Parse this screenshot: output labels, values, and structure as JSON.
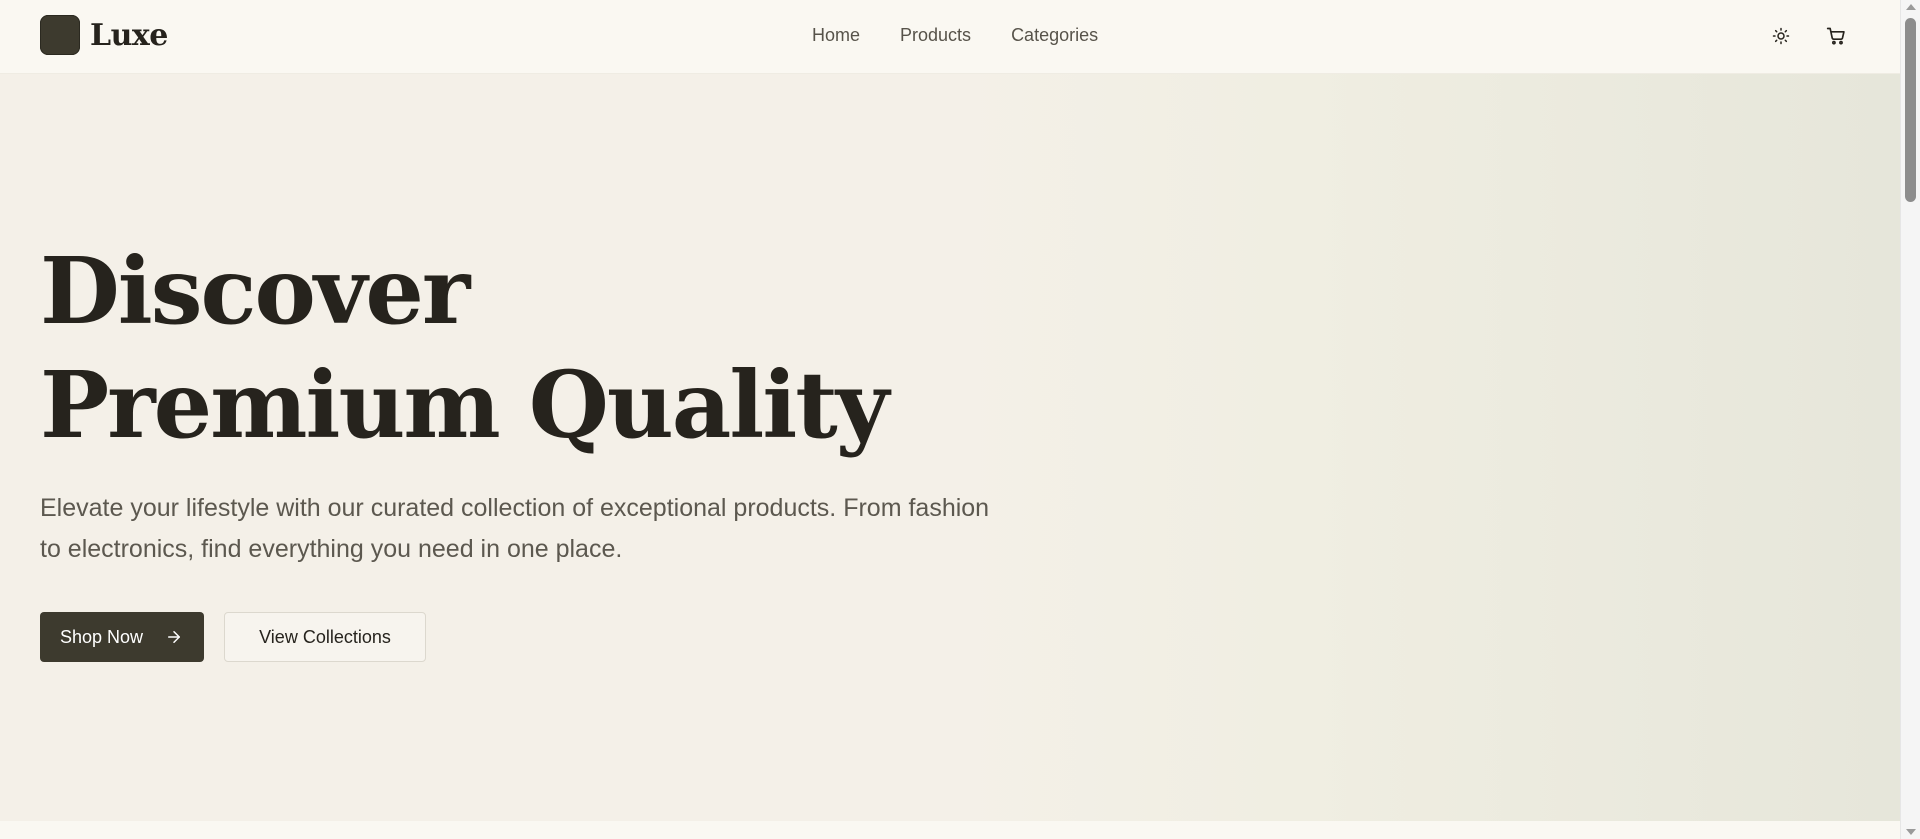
{
  "brand": {
    "name": "Luxe",
    "logo_color": "#3d3a2e"
  },
  "nav": {
    "items": [
      {
        "label": "Home"
      },
      {
        "label": "Products"
      },
      {
        "label": "Categories"
      }
    ]
  },
  "header_actions": {
    "theme_toggle_icon": "sun-icon",
    "cart_icon": "cart-icon"
  },
  "hero": {
    "title_line1": "Discover",
    "title_line2": "Premium Quality",
    "subtitle": "Elevate your lifestyle with our curated collection of exceptional products. From fashion to electronics, find everything you need in one place.",
    "primary_cta": "Shop Now",
    "primary_cta_icon": "arrow-right-icon",
    "secondary_cta": "View Collections"
  },
  "colors": {
    "primary": "#3d3a2e",
    "text": "#26231d",
    "muted_text": "#5c584f",
    "background": "#faf8f2",
    "hero_background": "#f4f0e8"
  }
}
